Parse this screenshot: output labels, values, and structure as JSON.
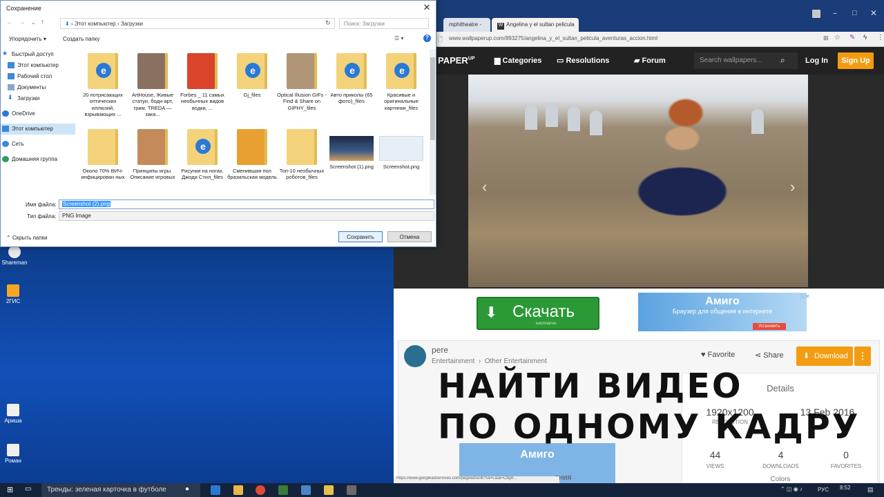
{
  "desktop": {
    "icons": [
      {
        "label": "Shareman"
      },
      {
        "label": "2ГИС"
      },
      {
        "label": "Ариша"
      },
      {
        "label": "Роман"
      }
    ]
  },
  "browser": {
    "tabs": [
      "mphitheatre - ",
      "Angelina y el sultan pelicula"
    ],
    "tab_favicon": "W",
    "url": "www.wallpaperup.com/893275/angelina_y_el_sultan_pelicula_aventuras_accion.html",
    "site": {
      "logo": "PAPER",
      "logo_sup": "UP",
      "nav": [
        "Categories",
        "Resolutions",
        "Forum"
      ],
      "search_placeholder": "Search wallpapers...",
      "login": "Log In",
      "signup": "Sign Up"
    },
    "ad_download": {
      "label": "Скачать",
      "sub": "Бесплатно"
    },
    "ad_amigo": {
      "logo": "Амиго",
      "text": "Браузер для общения в интернете",
      "button": "Установить"
    },
    "author": {
      "name": "pere",
      "category": "Entertainment",
      "subcategory": "Other Entertainment"
    },
    "actions": {
      "favorite": "Favorite",
      "share": "Share",
      "download": "Download"
    },
    "details": {
      "title": "Details",
      "resolution": "1920x1200",
      "resolution_label": "RESOLUTION",
      "date": "13 Feb 2016",
      "views": "44",
      "views_label": "VIEWS",
      "downloads": "4",
      "downloads_label": "DOWNLOADS",
      "favorites": "0",
      "favorites_label": "FAVORITES",
      "colors_label": "Colors"
    },
    "ad_bottom": {
      "logo": "Амиго",
      "text": "ения"
    },
    "status_url": "https://www.googleadservices.com/pagead/aclk?sa=L&ai=C8g8..."
  },
  "overlay": {
    "line1": "НАЙТИ ВИДЕО",
    "line2": "ПО ОДНОМУ КАДРУ"
  },
  "dialog": {
    "title": "Сохранение",
    "breadcrumb": [
      "Этот компьютер",
      "Загрузки"
    ],
    "search_placeholder": "Поиск: Загрузки",
    "organize": "Упорядочить ▾",
    "new_folder": "Создать папку",
    "nav": [
      {
        "label": "Быстрый доступ"
      },
      {
        "label": "Этот компьютер"
      },
      {
        "label": "Рабочий стол"
      },
      {
        "label": "Документы"
      },
      {
        "label": "Загрузки"
      },
      {
        "label": "OneDrive"
      },
      {
        "label": "Этот компьютер"
      },
      {
        "label": "Сеть"
      },
      {
        "label": "Домашняя группа"
      }
    ],
    "files": [
      {
        "name": "20 потрясающих оптических иллюзий, взрывающих ..."
      },
      {
        "name": "ArtHouse, Живые статуи, боди-арт, грим. TREDA — зака..."
      },
      {
        "name": "Forbes _ 11 самых необычных видов водки, ..."
      },
      {
        "name": "Gj_files"
      },
      {
        "name": "Optical Illusion GIFs - Find & Share on GIPHY_files"
      },
      {
        "name": "Авто приколы (65 фото)_files"
      },
      {
        "name": "Красивые и оригинальные картинки_files"
      },
      {
        "name": "Около 70% ВИЧ-инфицирован ных"
      },
      {
        "name": "Принципы игры. Описание игровых"
      },
      {
        "name": "Рисунки на ногах. Джоди Стил_files"
      },
      {
        "name": "Сменившая пол бразильская модель"
      },
      {
        "name": "Топ-10 необычных роботов_files"
      },
      {
        "name": "Screenshot (1).png"
      },
      {
        "name": "Screenshot.png"
      }
    ],
    "filename_label": "Имя файла:",
    "filename_value": "Screenshot (2).png",
    "filetype_label": "Тип файла:",
    "filetype_value": "PNG Image",
    "hide_folders": "Скрыть папки",
    "save": "Сохранить",
    "cancel": "Отмена"
  },
  "taskbar": {
    "search_text": "Тренды: зеленая карточка в футболе",
    "lang": "РУС",
    "time": "8:52"
  }
}
